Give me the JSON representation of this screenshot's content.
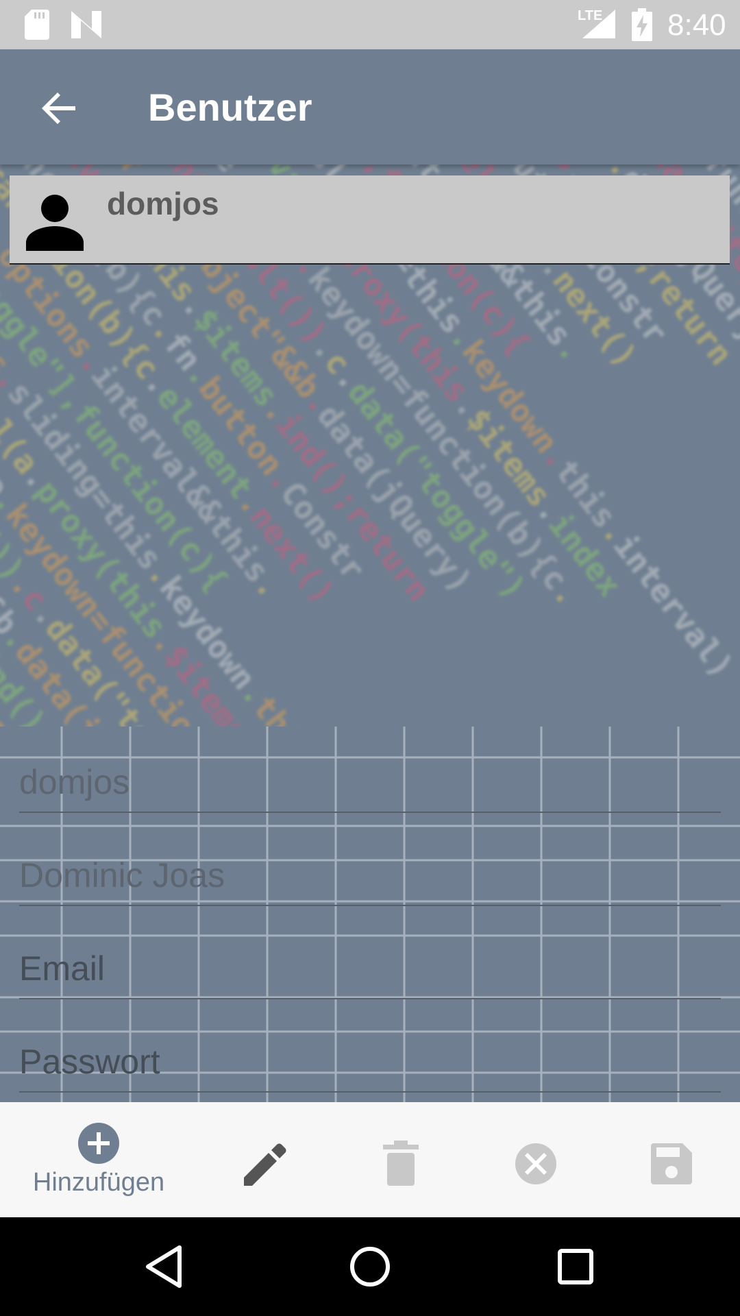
{
  "status_bar": {
    "network": "LTE",
    "time": "8:40",
    "icons": [
      "sd-card-icon",
      "n-logo-icon",
      "signal-icon",
      "battery-charging-icon"
    ]
  },
  "app_bar": {
    "title": "Benutzer",
    "back_icon": "arrow-back-icon"
  },
  "user_list": [
    {
      "username": "domjos",
      "icon": "person-icon"
    }
  ],
  "form": {
    "username_value": "domjos",
    "fullname_value": "Dominic Joas",
    "email_hint": "Email",
    "password_hint": "Passwort"
  },
  "actions": {
    "add_label": "Hinzufügen",
    "icons": [
      "add-circle-icon",
      "edit-pencil-icon",
      "delete-trash-icon",
      "cancel-icon",
      "save-floppy-icon"
    ]
  },
  "colors": {
    "primary": "#6f7f91",
    "status_bar": "#cbcbcb",
    "list_item_bg": "#c9c9c9",
    "action_bar_bg": "#f7f7f7",
    "disabled_icon": "#c8c8c8"
  },
  "background_code": [
    "proxy(this.sliding=this.keydown.this.interval)",
    "this.interval(a.proxy(this.$items.index",
    "prototype.pause.keydown=function(b){c.",
    "e.preventDefault()).c.data(\"toggle\")",
    "typeof b==\"object\"&&b.data(jQuery)",
    "active\").this.$items.ind();return",
    "function(b){c.fn.button.Constr",
    "transition(b){c.element.next()",
    "this.options.interval&&this.",
    "data-toggle\"],function(c){"
  ]
}
